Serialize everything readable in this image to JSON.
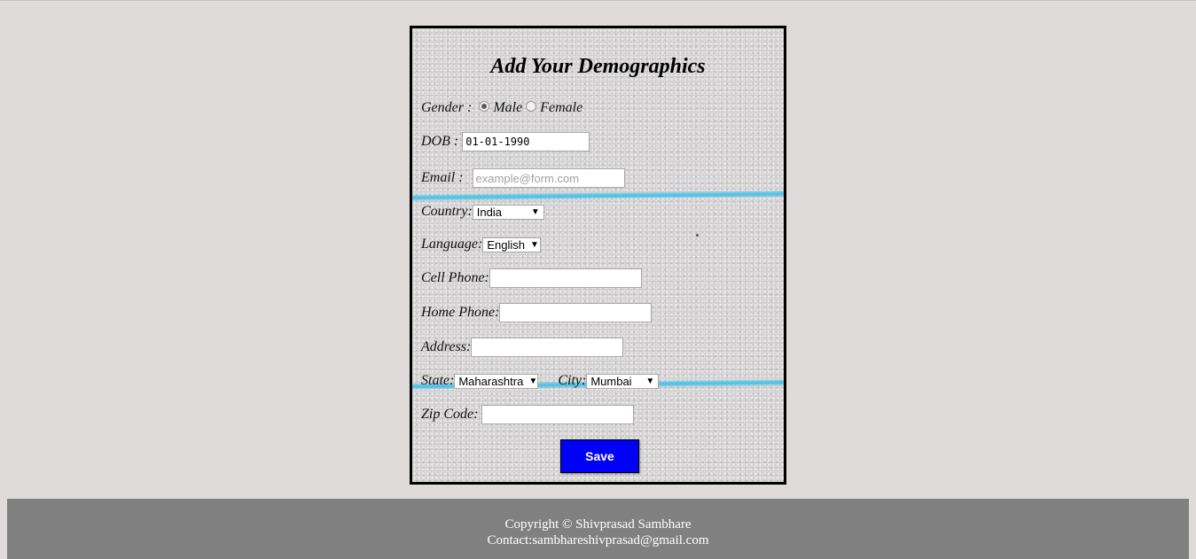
{
  "form": {
    "title": "Add Your Demographics",
    "gender": {
      "label": "Gender :",
      "options": [
        "Male",
        "Female"
      ],
      "selected": "Male"
    },
    "dob": {
      "label": "DOB :",
      "value": "01-01-1990"
    },
    "email": {
      "label": "Email :",
      "value": "",
      "placeholder": "example@form.com"
    },
    "country": {
      "label": "Country:",
      "selected": "India"
    },
    "language": {
      "label": "Language:",
      "selected": "English"
    },
    "cell_phone": {
      "label": "Cell Phone:",
      "value": ""
    },
    "home_phone": {
      "label": "Home Phone:",
      "value": ""
    },
    "address": {
      "label": "Address:",
      "value": ""
    },
    "state": {
      "label": "State:",
      "selected": "Maharashtra"
    },
    "city": {
      "label": "City:",
      "selected": "Mumbai"
    },
    "zip_code": {
      "label": "Zip Code:",
      "value": ""
    },
    "save_label": "Save"
  },
  "footer": {
    "copyright": "Copyright © Shivprasad Sambhare",
    "contact": "Contact:sambhareshivprasad@gmail.com"
  },
  "colors": {
    "page_bg": "#dedbda",
    "save_button": "#0000f5",
    "footer_bg": "#808080",
    "ruled_line": "#54c8e8"
  }
}
